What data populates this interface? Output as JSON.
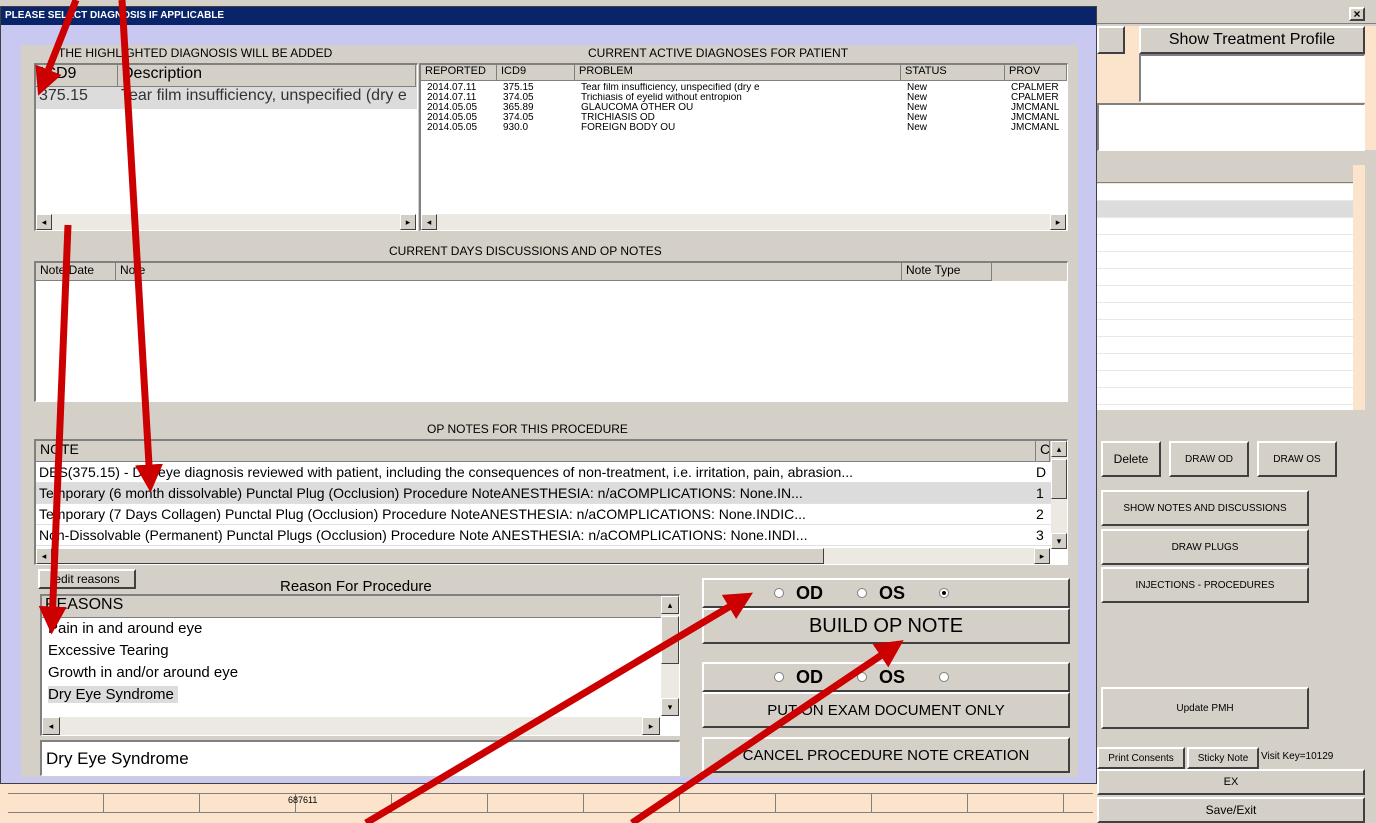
{
  "dialog": {
    "title": "PLEASE SELECT DIAGNOSIS IF APPLICABLE",
    "close_glyph": "×"
  },
  "highlighted": {
    "label": "THE HIGHLIGHTED DIAGNOSIS WILL BE ADDED",
    "headers": [
      "ICD9",
      "Description"
    ],
    "rows": [
      {
        "code": "375.15",
        "desc": "Tear film insufficiency, unspecified (dry e"
      }
    ]
  },
  "active": {
    "label": "CURRENT ACTIVE DIAGNOSES FOR PATIENT",
    "headers": [
      "REPORTED",
      "ICD9",
      "PROBLEM",
      "STATUS",
      "PROV"
    ],
    "rows": [
      [
        "2014.07.11",
        "375.15",
        "Tear film insufficiency, unspecified (dry e",
        "New",
        "CPALMER"
      ],
      [
        "2014.07.11",
        "374.05",
        "Trichiasis of eyelid without entropion",
        "New",
        "CPALMER"
      ],
      [
        "2014.05.05",
        "365.89",
        "GLAUCOMA OTHER OU",
        "New",
        "JMCMANL"
      ],
      [
        "2014.05.05",
        "374.05",
        "TRICHIASIS OD",
        "New",
        "JMCMANL"
      ],
      [
        "2014.05.05",
        "930.0",
        "FOREIGN BODY OU",
        "New",
        "JMCMANL"
      ]
    ]
  },
  "discussions": {
    "label": "CURRENT DAYS DISCUSSIONS AND OP NOTES",
    "headers": [
      "Note Date",
      "Note",
      "Note Type"
    ]
  },
  "opnotes": {
    "label": "OP NOTES FOR THIS PROCEDURE",
    "headers": [
      "NOTE",
      "C"
    ],
    "rows": [
      [
        "DES(375.15) - Dry eye diagnosis reviewed with patient, including the consequences of non-treatment, i.e. irritation, pain, abrasion...",
        "D"
      ],
      [
        "Temporary (6 month dissolvable) Punctal Plug (Occlusion) Procedure NoteANESTHESIA: n/aCOMPLICATIONS: None.IN...",
        "1"
      ],
      [
        "Temporary (7 Days Collagen) Punctal Plug (Occlusion) Procedure NoteANESTHESIA: n/aCOMPLICATIONS: None.INDIC...",
        "2"
      ],
      [
        "Non-Dissolvable (Permanent) Punctal Plugs (Occlusion) Procedure Note ANESTHESIA: n/aCOMPLICATIONS: None.INDI...",
        "3"
      ]
    ]
  },
  "reasons": {
    "edit_label": "edit reasons",
    "label": "Reason For Procedure",
    "header": "REASONS",
    "items": [
      "Pain in and around eye",
      "Excessive Tearing",
      "Growth in and/or around eye",
      "Dry Eye Syndrome"
    ],
    "selected_value": "Dry Eye Syndrome"
  },
  "eye_select_1": {
    "od": "OD",
    "os": "OS",
    "selected": "ou"
  },
  "build_op_note": "BUILD OP NOTE",
  "eye_select_2": {
    "od": "OD",
    "os": "OS",
    "selected": "none"
  },
  "put_on_exam": "PUT ON EXAM DOCUMENT ONLY",
  "cancel": "CANCEL PROCEDURE NOTE CREATION",
  "right_panel": {
    "show_treatment": "Show Treatment Profile",
    "delete": "Delete",
    "draw_od": "DRAW OD",
    "draw_os": "DRAW OS",
    "show_notes": "SHOW NOTES AND DISCUSSIONS",
    "draw_plugs": "DRAW PLUGS",
    "injections": "INJECTIONS - PROCEDURES",
    "update_pmh": "Update PMH",
    "print_consents": "Print Consents",
    "sticky_note": "Sticky Note",
    "visit_key": "Visit Key=10129",
    "ex": "EX",
    "save_exit": "Save/Exit"
  },
  "bottom_strip": {
    "value": "687611"
  },
  "colors": {
    "title_bar": "#0a246a",
    "dialog_bg": "#c8c8f0",
    "annotation_arrow": "#cc0000",
    "selection": "#dcdcdc"
  }
}
